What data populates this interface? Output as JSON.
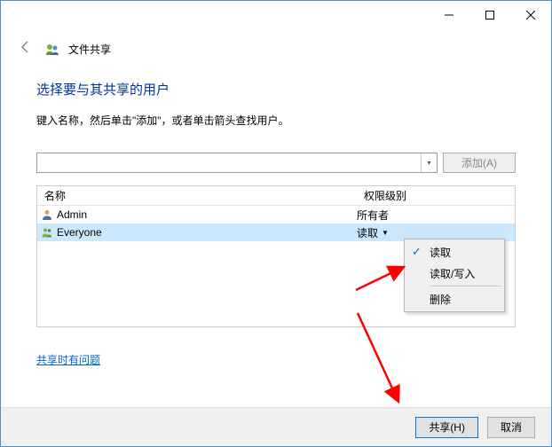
{
  "titlebar": {
    "title": "文件共享"
  },
  "heading": "选择要与其共享的用户",
  "subtext": "键入名称，然后单击\"添加\"，或者单击箭头查找用户。",
  "input": {
    "value": "",
    "placeholder": ""
  },
  "add_button": "添加(A)",
  "columns": {
    "name": "名称",
    "perm": "权限级别"
  },
  "rows": [
    {
      "icon": "user",
      "name": "Admin",
      "perm": "所有者",
      "selected": false,
      "dropdown": false
    },
    {
      "icon": "group",
      "name": "Everyone",
      "perm": "读取",
      "selected": true,
      "dropdown": true
    }
  ],
  "menu": {
    "items": [
      {
        "label": "读取",
        "checked": true
      },
      {
        "label": "读取/写入",
        "checked": false
      }
    ],
    "separator": true,
    "remove": "删除"
  },
  "help_link": "共享时有问题",
  "footer": {
    "share": "共享(H)",
    "cancel": "取消"
  }
}
